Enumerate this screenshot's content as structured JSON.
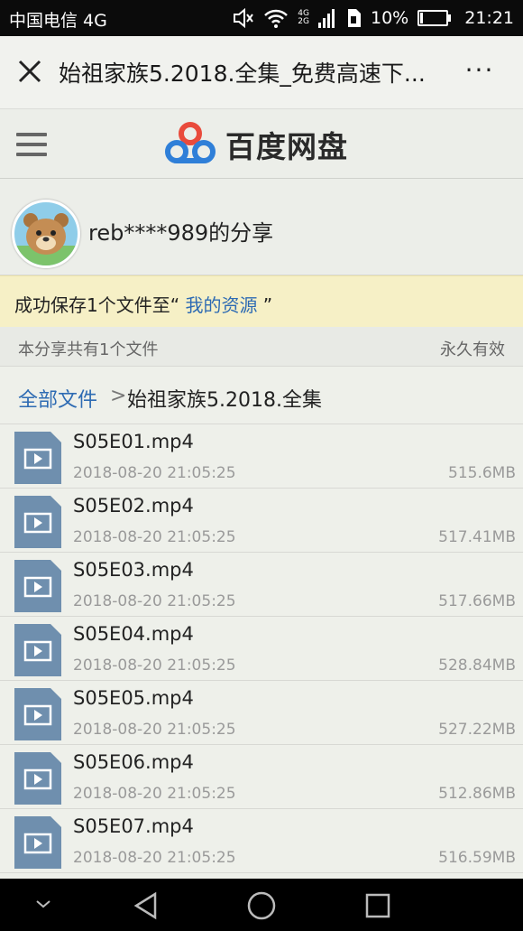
{
  "status_bar": {
    "carrier": "中国电信 4G",
    "network_top": "4G",
    "network_bottom": "2G",
    "battery": "10%",
    "battery_level": 0.1,
    "time": "21:21",
    "icons": [
      "mute-icon",
      "wifi-icon",
      "signal-icon",
      "sim-icon",
      "battery-icon"
    ]
  },
  "title_bar": {
    "title": "始祖家族5.2018.全集_免费高速下...",
    "more": "···"
  },
  "header": {
    "brand": "百度网盘"
  },
  "share": {
    "owner_label": "reb****989的分享"
  },
  "notice": {
    "prefix": "成功保存1个文件至“ ",
    "link": "我的资源",
    "suffix": " ”"
  },
  "summary": {
    "count_text": "本分享共有1个文件",
    "validity": "永久有效"
  },
  "breadcrumb": {
    "root": "全部文件",
    "separator": ">",
    "current": "始祖家族5.2018.全集"
  },
  "files": [
    {
      "name": "S05E01.mp4",
      "date": "2018-08-20 21:05:25",
      "size": "515.6MB"
    },
    {
      "name": "S05E02.mp4",
      "date": "2018-08-20 21:05:25",
      "size": "517.41MB"
    },
    {
      "name": "S05E03.mp4",
      "date": "2018-08-20 21:05:25",
      "size": "517.66MB"
    },
    {
      "name": "S05E04.mp4",
      "date": "2018-08-20 21:05:25",
      "size": "528.84MB"
    },
    {
      "name": "S05E05.mp4",
      "date": "2018-08-20 21:05:25",
      "size": "527.22MB"
    },
    {
      "name": "S05E06.mp4",
      "date": "2018-08-20 21:05:25",
      "size": "512.86MB"
    },
    {
      "name": "S05E07.mp4",
      "date": "2018-08-20 21:05:25",
      "size": "516.59MB"
    }
  ],
  "colors": {
    "link": "#2e6bb3",
    "notice_bg": "#f6f0c6",
    "file_icon": "#6f8fae",
    "logo_blue": "#2f7fd8"
  }
}
